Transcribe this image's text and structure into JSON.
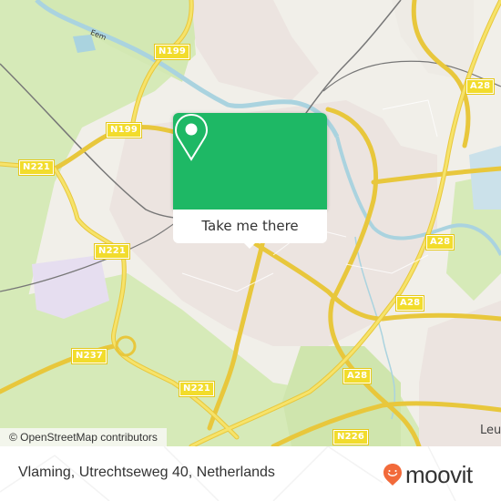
{
  "map": {
    "road_shields": [
      {
        "label": "N199",
        "id": "n199-north"
      },
      {
        "label": "N199",
        "id": "n199-west"
      },
      {
        "label": "N221",
        "id": "n221-west"
      },
      {
        "label": "N221",
        "id": "n221-mid"
      },
      {
        "label": "N237",
        "id": "n237"
      },
      {
        "label": "N221",
        "id": "n221-south"
      },
      {
        "label": "A28",
        "id": "a28-north"
      },
      {
        "label": "A28",
        "id": "a28-mid"
      },
      {
        "label": "A28",
        "id": "a28-east"
      },
      {
        "label": "A28",
        "id": "a28-south"
      },
      {
        "label": "N226",
        "id": "n226"
      }
    ],
    "river_label": "Eem",
    "place_label": "Leu",
    "attribution": "© OpenStreetMap contributors",
    "colors": {
      "land": "#f1efe9",
      "green": "#d6eab8",
      "urban": "#ece4e0",
      "water": "#aad3df",
      "road": "#f6dd4e",
      "rail": "#777777",
      "popup_accent": "#1eb865",
      "brand_orange": "#f26a3a"
    }
  },
  "popup": {
    "icon": "map-pin-icon",
    "button_label": "Take me there"
  },
  "footer": {
    "address": "Vlaming, Utrechtseweg 40, Netherlands",
    "brand": "moovit",
    "brand_icon": "moovit-logo-icon"
  }
}
